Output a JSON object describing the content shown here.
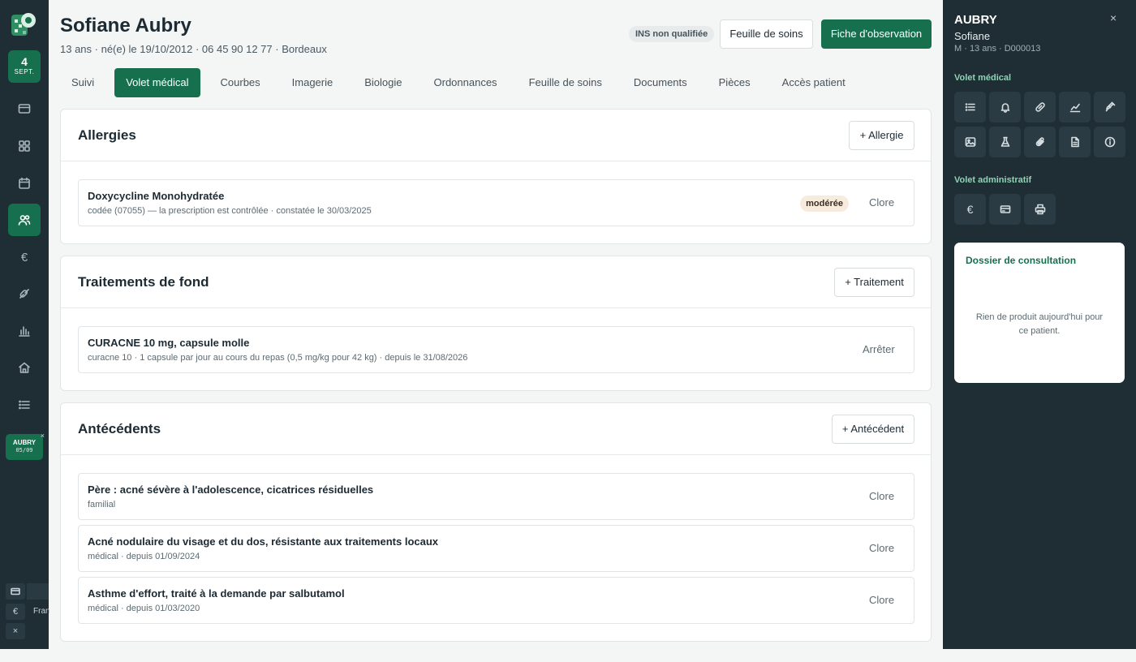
{
  "rail": {
    "date_day": "4",
    "date_month": "SEPT.",
    "icons": [
      "card-icon",
      "grid-icon",
      "calendar-icon",
      "users-icon",
      "euro-icon",
      "pill-icon",
      "bar-chart-icon",
      "home-icon",
      "list-icon"
    ],
    "euro_glyph": "€",
    "patient_chip": {
      "name": "AUBRY",
      "date": "05/09",
      "close": "×"
    },
    "mini_label": "Fran",
    "mini_close": "×"
  },
  "patient": {
    "name": "Sofiane Aubry",
    "meta": "13 ans · né(e) le 19/10/2012 · 06 45 90 12 77 · Bordeaux",
    "ins_status": "INS non qualifiée"
  },
  "header_actions": {
    "care_sheet": "Feuille de soins",
    "observation": "Fiche d'observation"
  },
  "tabs": [
    {
      "label": "Suivi"
    },
    {
      "label": "Volet médical"
    },
    {
      "label": "Courbes"
    },
    {
      "label": "Imagerie"
    },
    {
      "label": "Biologie"
    },
    {
      "label": "Ordonnances"
    },
    {
      "label": "Feuille de soins"
    },
    {
      "label": "Documents"
    },
    {
      "label": "Pièces"
    },
    {
      "label": "Accès patient"
    }
  ],
  "allergies": {
    "title": "Allergies",
    "add_label": "+ Allergie",
    "items": [
      {
        "title": "Doxycycline Monohydratée",
        "sub": "codée (07055) — la prescription est contrôlée · constatée le 30/03/2025",
        "severity": "modérée",
        "action": "Clore"
      }
    ]
  },
  "treatments": {
    "title": "Traitements de fond",
    "add_label": "+ Traitement",
    "items": [
      {
        "title": "CURACNE 10 mg, capsule molle",
        "sub": "curacne 10 · 1 capsule par jour au cours du repas (0,5 mg/kg pour 42 kg) · depuis le 31/08/2026",
        "action": "Arrêter"
      }
    ]
  },
  "history": {
    "title": "Antécédents",
    "add_label": "+ Antécédent",
    "items": [
      {
        "title": "Père : acné sévère à l'adolescence, cicatrices résiduelles",
        "sub": "familial",
        "action": "Clore"
      },
      {
        "title": "Acné nodulaire du visage et du dos, résistante aux traitements locaux",
        "sub": "médical · depuis 01/09/2024",
        "action": "Clore"
      },
      {
        "title": "Asthme d'effort, traité à la demande par salbutamol",
        "sub": "médical · depuis 01/03/2020",
        "action": "Clore"
      }
    ]
  },
  "panel": {
    "last_name": "AUBRY",
    "first_name": "Sofiane",
    "meta": "M · 13 ans · D000013",
    "close": "×",
    "medical_title": "Volet médical",
    "medical_tools": [
      "list-icon",
      "bell-icon",
      "bandage-icon",
      "chart-line-icon",
      "syringe-icon",
      "image-icon",
      "flask-icon",
      "paperclip-icon",
      "document-icon",
      "info-icon"
    ],
    "admin_title": "Volet administratif",
    "admin_tools": [
      "euro-icon",
      "card-icon",
      "printer-icon"
    ],
    "euro_glyph": "€",
    "dossier_title": "Dossier de consultation",
    "dossier_empty": "Rien de produit aujourd'hui pour ce patient."
  },
  "colors": {
    "accent": "#16704e",
    "dark": "#1f2d34",
    "panel_heading": "#8fd3b5"
  }
}
